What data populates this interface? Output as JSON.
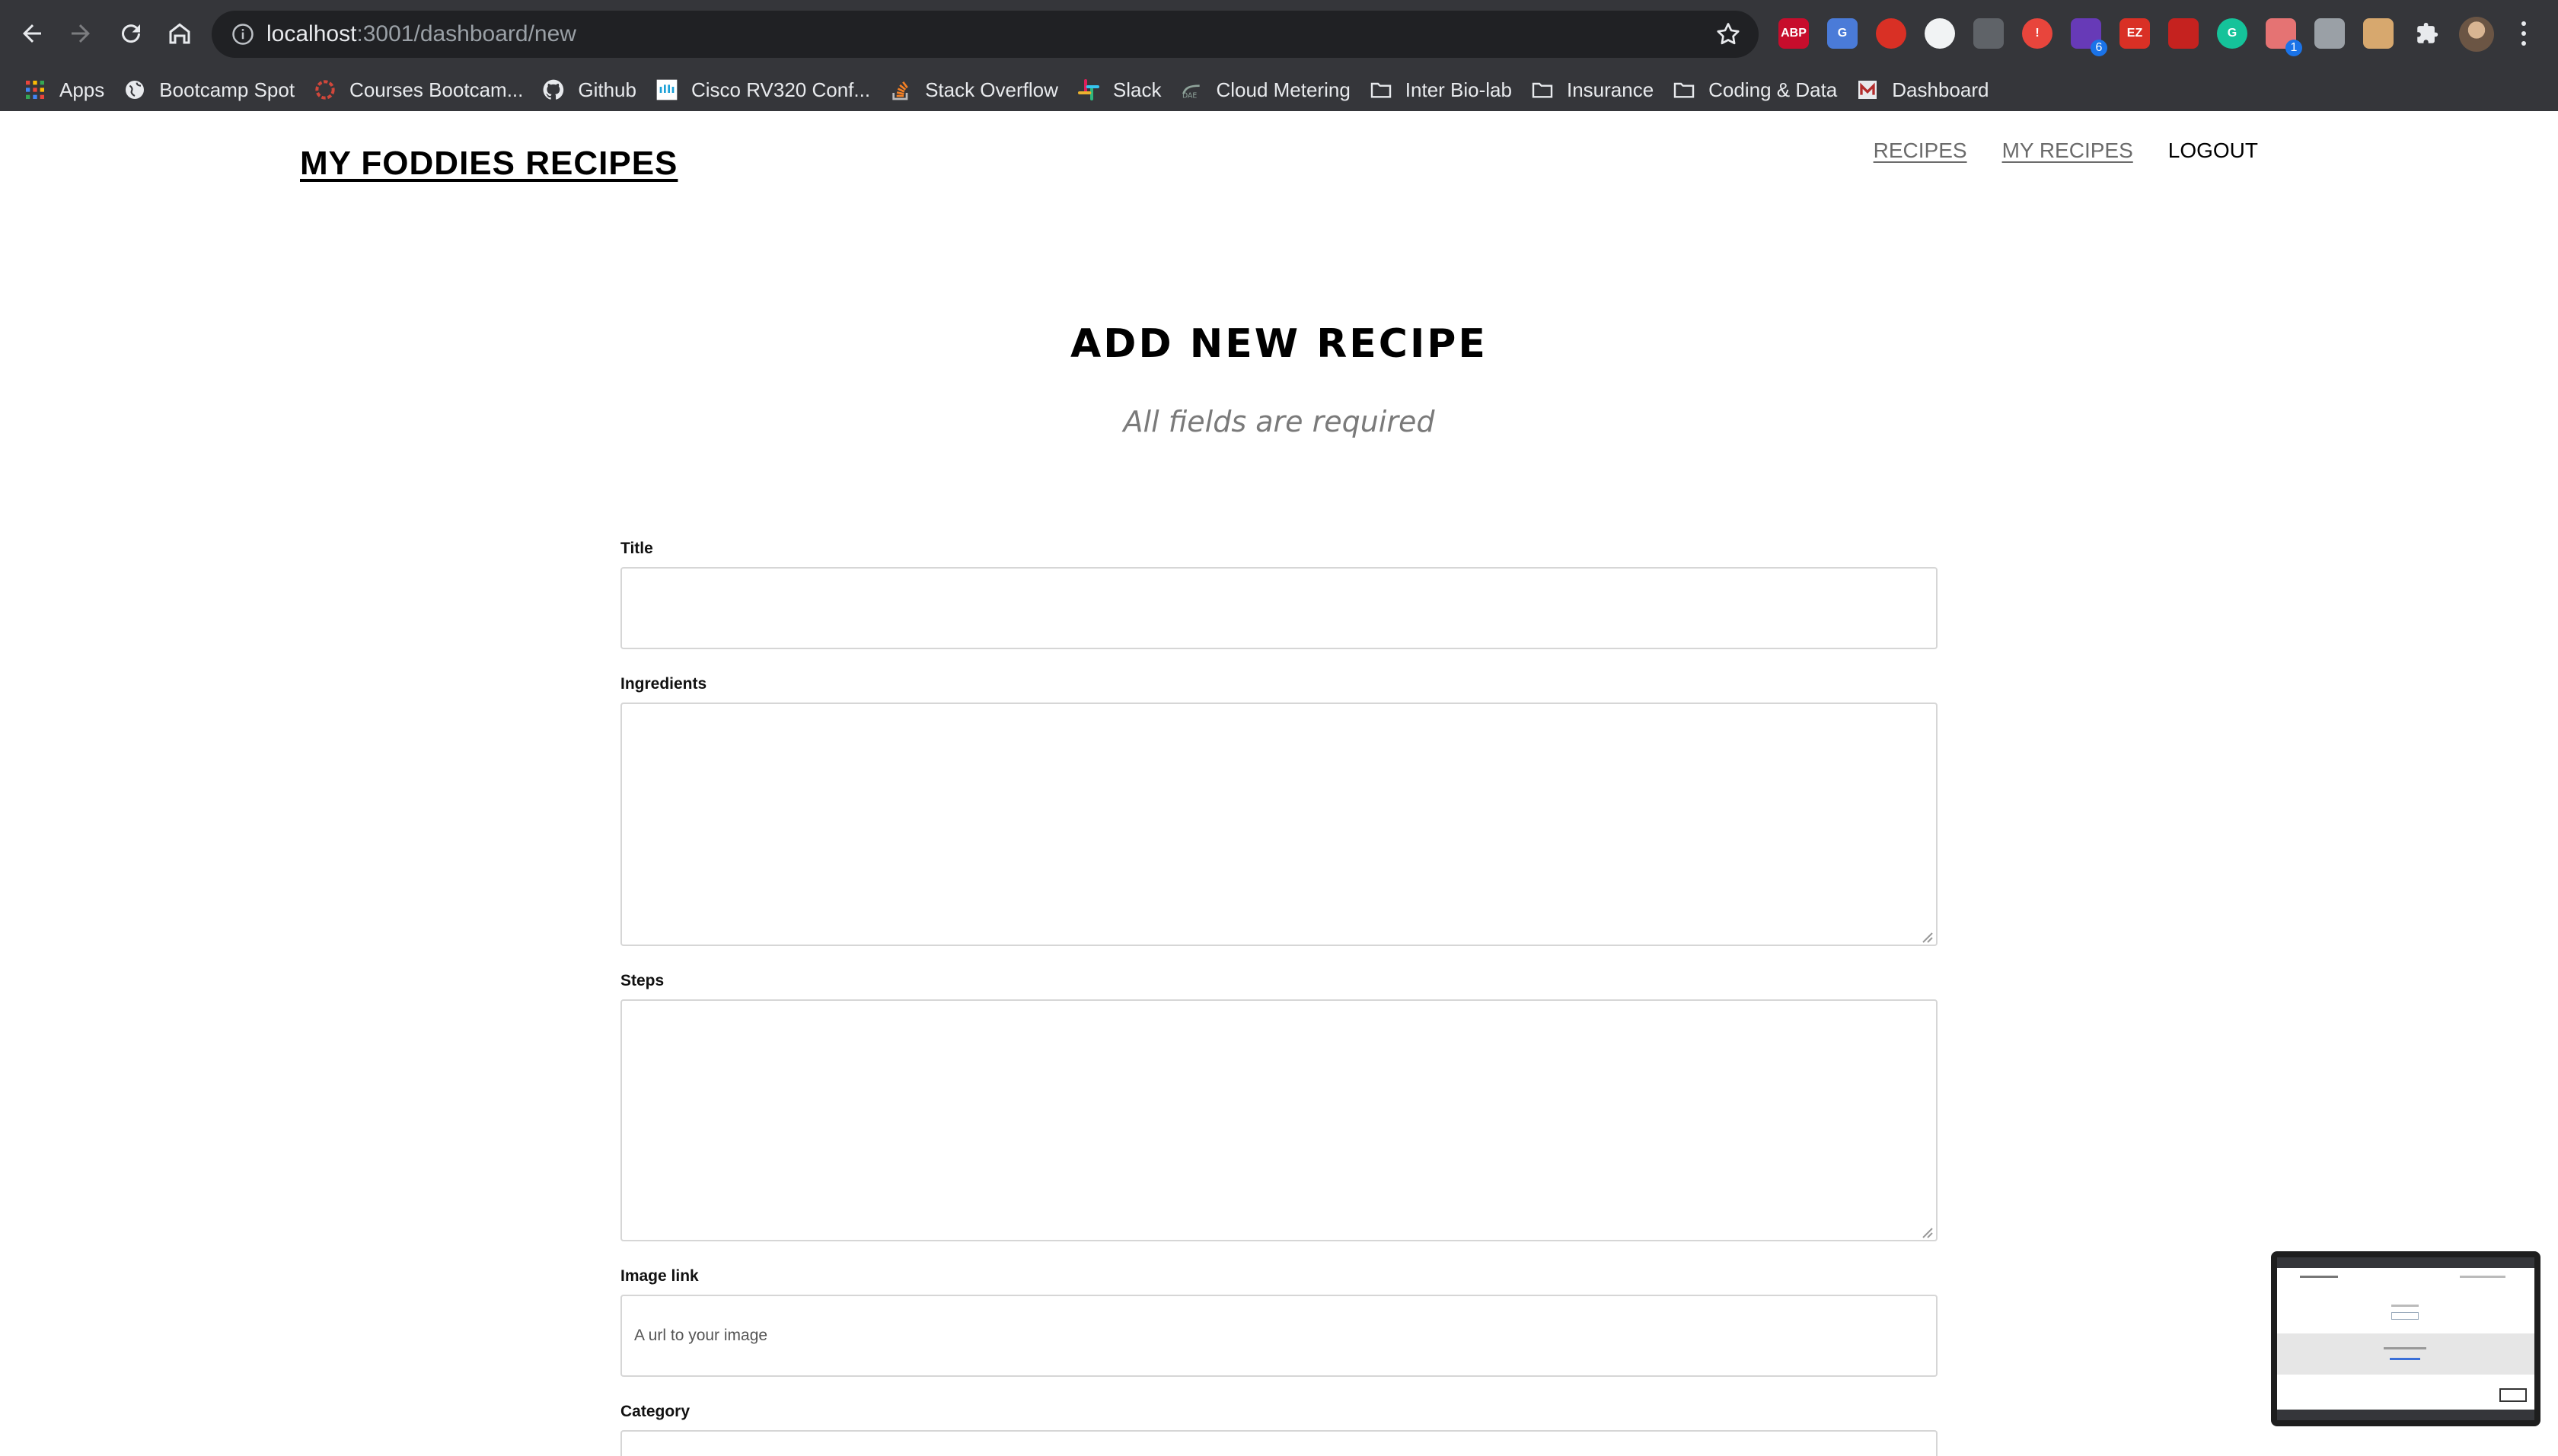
{
  "browser": {
    "url_host": "localhost",
    "url_rest": ":3001/dashboard/new",
    "extensions": [
      {
        "name": "adblock-plus-icon",
        "label": "ABP",
        "color": "#c70d2c"
      },
      {
        "name": "google-translate-icon",
        "label": "G",
        "color": "#4a7bd8"
      },
      {
        "name": "stop-hand-icon",
        "label": "",
        "color": "#d93025"
      },
      {
        "name": "circle-extension-icon",
        "label": "",
        "color": "#f1f3f4"
      },
      {
        "name": "script-extension-icon",
        "label": "",
        "color": "#5f6368"
      },
      {
        "name": "alert-extension-icon",
        "label": "!",
        "color": "#e8453c"
      },
      {
        "name": "shapes-extension-icon",
        "label": "",
        "color": "#673ab7",
        "badge": "6"
      },
      {
        "name": "ez-extension-icon",
        "label": "EZ",
        "color": "#d93025"
      },
      {
        "name": "pdf-extension-icon",
        "label": "",
        "color": "#c5221f"
      },
      {
        "name": "grammarly-icon",
        "label": "G",
        "color": "#15c39a"
      },
      {
        "name": "recorder-extension-icon",
        "label": "",
        "color": "#e57373",
        "badge": "1"
      },
      {
        "name": "camera-extension-icon",
        "label": "",
        "color": "#9aa0a6"
      },
      {
        "name": "cookie-extension-icon",
        "label": "",
        "color": "#d7a86e"
      },
      {
        "name": "puzzle-extensions-icon",
        "label": "",
        "color": "#e8eaed"
      }
    ]
  },
  "bookmarks": [
    {
      "label": "Apps",
      "icon": "apps-grid-icon"
    },
    {
      "label": "Bootcamp Spot",
      "icon": "globe-icon"
    },
    {
      "label": "Courses Bootcam...",
      "icon": "bootcamp-icon"
    },
    {
      "label": "Github",
      "icon": "github-icon"
    },
    {
      "label": "Cisco RV320 Conf...",
      "icon": "cisco-icon"
    },
    {
      "label": "Stack Overflow",
      "icon": "stackoverflow-icon"
    },
    {
      "label": "Slack",
      "icon": "slack-icon"
    },
    {
      "label": "Cloud Metering",
      "icon": "cloud-metering-icon"
    },
    {
      "label": "Inter Bio-lab",
      "icon": "folder-icon"
    },
    {
      "label": "Insurance",
      "icon": "folder-icon"
    },
    {
      "label": "Coding & Data",
      "icon": "folder-icon"
    },
    {
      "label": "Dashboard",
      "icon": "dashboard-icon"
    }
  ],
  "site": {
    "title": "MY FODDIES RECIPES",
    "nav": [
      {
        "label": "RECIPES"
      },
      {
        "label": "MY RECIPES"
      },
      {
        "label": "LOGOUT"
      }
    ]
  },
  "form": {
    "heading": "ADD NEW RECIPE",
    "subheading": "All fields are required",
    "title_label": "Title",
    "title_value": "",
    "ingredients_label": "Ingredients",
    "ingredients_value": "",
    "steps_label": "Steps",
    "steps_value": "",
    "image_label": "Image link",
    "image_placeholder": "A url to your image",
    "category_label": "Category"
  }
}
